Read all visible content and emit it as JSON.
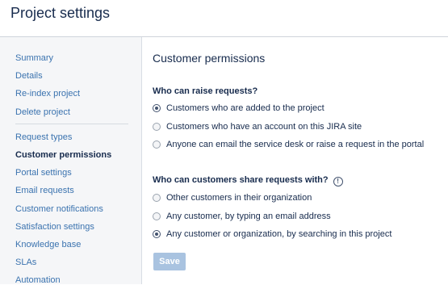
{
  "header": {
    "title": "Project settings"
  },
  "sidebar": {
    "items": [
      {
        "label": "Summary"
      },
      {
        "label": "Details"
      },
      {
        "label": "Re-index project"
      },
      {
        "label": "Delete project"
      },
      {
        "label": "Request types"
      },
      {
        "label": "Customer permissions",
        "active": true
      },
      {
        "label": "Portal settings"
      },
      {
        "label": "Email requests"
      },
      {
        "label": "Customer notifications"
      },
      {
        "label": "Satisfaction settings"
      },
      {
        "label": "Knowledge base"
      },
      {
        "label": "SLAs"
      },
      {
        "label": "Automation"
      }
    ]
  },
  "main": {
    "section_title": "Customer permissions",
    "raise_requests": {
      "label": "Who can raise requests?",
      "options": [
        {
          "label": "Customers who are added to the project",
          "selected": true
        },
        {
          "label": "Customers who have an account on this JIRA site",
          "selected": false
        },
        {
          "label": "Anyone can email the service desk or raise a request in the portal",
          "selected": false
        }
      ]
    },
    "share_requests": {
      "label": "Who can customers share requests with?",
      "info_icon": "info-icon",
      "info_glyph": "!",
      "options": [
        {
          "label": "Other customers in their organization",
          "selected": false
        },
        {
          "label": "Any customer, by typing an email address",
          "selected": false
        },
        {
          "label": "Any customer or organization, by searching in this project",
          "selected": true
        }
      ]
    },
    "save_label": "Save"
  },
  "colors": {
    "link": "#3b73af",
    "text": "#172b4d",
    "sidebar_bg": "#f5f6f8",
    "save_button_disabled": "#a9c3e0"
  }
}
